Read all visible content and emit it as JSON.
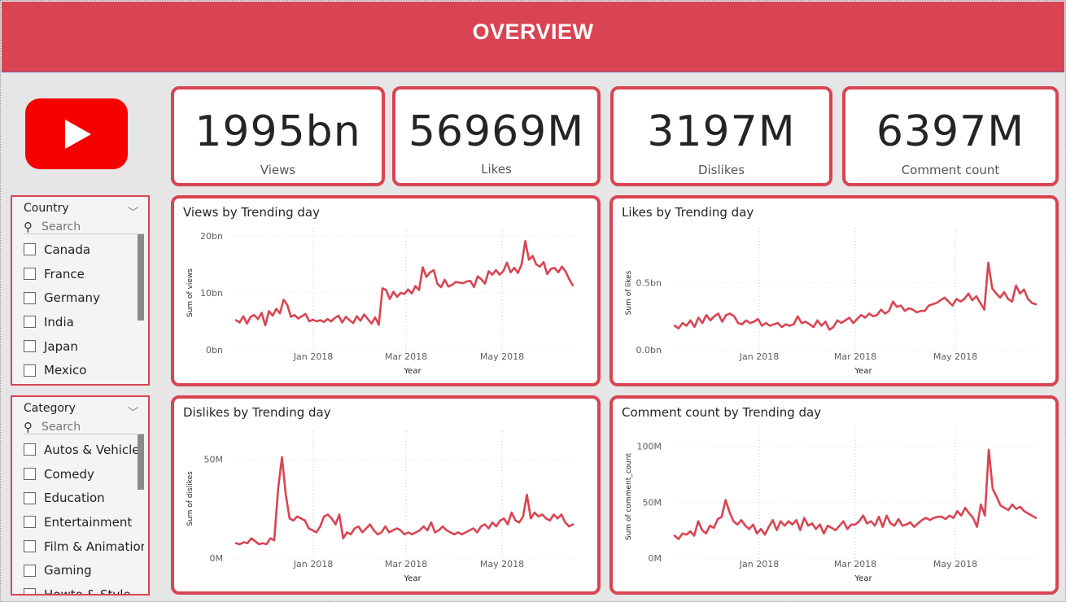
{
  "header": {
    "title": "OVERVIEW"
  },
  "logo": {
    "name": "youtube-logo",
    "color": "#f70000"
  },
  "slicers": [
    {
      "title": "Country",
      "search_placeholder": "Search",
      "items": [
        "Canada",
        "France",
        "Germany",
        "India",
        "Japan",
        "Mexico"
      ]
    },
    {
      "title": "Category",
      "search_placeholder": "Search",
      "items": [
        "Autos & Vehicles",
        "Comedy",
        "Education",
        "Entertainment",
        "Film & Animation",
        "Gaming",
        "Howto & Style"
      ]
    }
  ],
  "kpis": [
    {
      "value": "1995bn",
      "label": "Views"
    },
    {
      "value": "56969M",
      "label": "Likes"
    },
    {
      "value": "3197M",
      "label": "Dislikes"
    },
    {
      "value": "6397M",
      "label": "Comment count"
    }
  ],
  "colors": {
    "accent": "#d94452",
    "line": "#d94452",
    "background": "#e6e6e6"
  },
  "chart_data": [
    {
      "type": "line",
      "title": "Views by Trending day",
      "xlabel": "Year",
      "ylabel": "Sum of views",
      "x_ticks": [
        "Jan 2018",
        "Mar 2018",
        "May 2018"
      ],
      "y_ticks": [
        "0bn",
        "10bn",
        "20bn"
      ],
      "ylim": [
        0,
        20
      ],
      "unit": "bn",
      "series": [
        {
          "values": [
            5.2,
            4.8,
            5.9,
            4.6,
            5.8,
            6.1,
            5.4,
            6.5,
            4.3,
            6.8,
            6.0,
            7.2,
            6.4,
            8.8,
            7.9,
            5.8,
            6.1,
            5.5,
            5.9,
            6.3,
            5.0,
            5.3,
            5.0,
            5.2,
            4.9,
            5.4,
            5.0,
            5.6,
            6.0,
            4.8,
            5.8,
            5.2,
            4.7,
            5.9,
            5.1,
            6.2,
            5.4,
            4.6,
            5.7,
            4.4,
            10.8,
            10.5,
            8.9,
            10.2,
            9.3,
            10.0,
            9.8,
            10.6,
            9.9,
            11.2,
            10.5,
            14.5,
            12.8,
            13.6,
            14.0,
            11.6,
            11.0,
            12.3,
            11.1,
            11.4,
            11.9,
            11.8,
            11.7,
            12.0,
            12.1,
            11.0,
            12.9,
            12.4,
            11.6,
            13.8,
            13.2,
            14.0,
            13.2,
            13.8,
            15.3,
            13.6,
            14.4,
            13.5,
            15.0,
            19.1,
            15.8,
            16.5,
            15.0,
            14.6,
            15.4,
            13.3,
            14.2,
            14.4,
            13.6,
            14.6,
            13.8,
            12.4,
            11.3
          ]
        }
      ]
    },
    {
      "type": "line",
      "title": "Likes by Trending day",
      "xlabel": "Year",
      "ylabel": "Sum of likes",
      "x_ticks": [
        "Jan 2018",
        "Mar 2018",
        "May 2018"
      ],
      "y_ticks": [
        "0.0bn",
        "0.5bn"
      ],
      "ylim": [
        0,
        0.85
      ],
      "unit": "bn",
      "series": [
        {
          "values": [
            0.18,
            0.16,
            0.2,
            0.18,
            0.22,
            0.17,
            0.24,
            0.2,
            0.26,
            0.22,
            0.25,
            0.27,
            0.21,
            0.26,
            0.27,
            0.25,
            0.2,
            0.19,
            0.22,
            0.2,
            0.21,
            0.23,
            0.18,
            0.2,
            0.18,
            0.19,
            0.2,
            0.17,
            0.19,
            0.18,
            0.19,
            0.25,
            0.2,
            0.21,
            0.19,
            0.17,
            0.22,
            0.18,
            0.21,
            0.15,
            0.17,
            0.22,
            0.2,
            0.22,
            0.24,
            0.2,
            0.23,
            0.26,
            0.24,
            0.27,
            0.25,
            0.26,
            0.3,
            0.27,
            0.29,
            0.36,
            0.32,
            0.33,
            0.29,
            0.31,
            0.3,
            0.28,
            0.29,
            0.29,
            0.33,
            0.34,
            0.35,
            0.37,
            0.39,
            0.36,
            0.33,
            0.38,
            0.36,
            0.38,
            0.42,
            0.37,
            0.4,
            0.35,
            0.3,
            0.65,
            0.46,
            0.42,
            0.39,
            0.43,
            0.38,
            0.36,
            0.48,
            0.42,
            0.45,
            0.38,
            0.35,
            0.34
          ]
        }
      ]
    },
    {
      "type": "line",
      "title": "Dislikes by Trending day",
      "xlabel": "Year",
      "ylabel": "Sum of dislikes",
      "x_ticks": [
        "Jan 2018",
        "Mar 2018",
        "May 2018"
      ],
      "y_ticks": [
        "0M",
        "50M"
      ],
      "ylim": [
        0,
        60
      ],
      "unit": "M",
      "series": [
        {
          "values": [
            7.5,
            7,
            8,
            7.5,
            10,
            8.5,
            7,
            7.5,
            7,
            10,
            9,
            35,
            51,
            32,
            20,
            19,
            21,
            20,
            19,
            15,
            14,
            13,
            16,
            21,
            22,
            20,
            17,
            22,
            10,
            13,
            12,
            15,
            16,
            13,
            15,
            17,
            14,
            12,
            13,
            16,
            13,
            14,
            15,
            14,
            12,
            13,
            12,
            13,
            14,
            16,
            14,
            18,
            13,
            14,
            16,
            14,
            13,
            12,
            13,
            12,
            13,
            14,
            15,
            13,
            16,
            17,
            15,
            18,
            16,
            19,
            20,
            17,
            23,
            19,
            18,
            21,
            32,
            20,
            23,
            21,
            22,
            20,
            19,
            22,
            20,
            22,
            18,
            16,
            17
          ]
        }
      ]
    },
    {
      "type": "line",
      "title": "Comment count by Trending day",
      "xlabel": "Year",
      "ylabel": "Sum of comment_count",
      "x_ticks": [
        "Jan 2018",
        "Mar 2018",
        "May 2018"
      ],
      "y_ticks": [
        "0M",
        "50M",
        "100M"
      ],
      "ylim": [
        0,
        110
      ],
      "unit": "M",
      "series": [
        {
          "values": [
            20,
            17,
            22,
            21,
            24,
            20,
            33,
            25,
            22,
            29,
            27,
            35,
            37,
            52,
            41,
            33,
            30,
            34,
            29,
            26,
            30,
            22,
            26,
            21,
            28,
            34,
            25,
            33,
            29,
            33,
            30,
            34,
            25,
            36,
            29,
            31,
            26,
            30,
            22,
            29,
            27,
            25,
            29,
            33,
            26,
            30,
            30,
            33,
            38,
            31,
            33,
            29,
            37,
            28,
            38,
            31,
            29,
            35,
            29,
            30,
            32,
            28,
            31,
            34,
            36,
            34,
            36,
            37,
            37,
            35,
            38,
            36,
            42,
            38,
            45,
            40,
            36,
            28,
            48,
            38,
            97,
            62,
            55,
            47,
            45,
            43,
            48,
            44,
            46,
            42,
            40,
            38,
            36
          ]
        }
      ]
    }
  ]
}
